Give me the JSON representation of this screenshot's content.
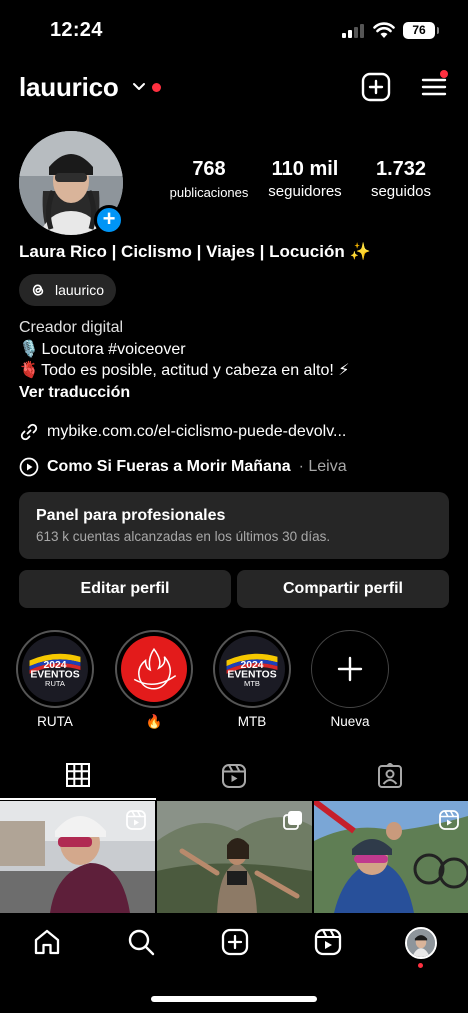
{
  "status": {
    "time": "12:24",
    "battery": "76"
  },
  "header": {
    "username": "lauurico"
  },
  "stats": {
    "posts": {
      "value": "768",
      "label": "publicaciones"
    },
    "followers": {
      "value": "110 mil",
      "label": "seguidores"
    },
    "following": {
      "value": "1.732",
      "label": "seguidos"
    }
  },
  "profile": {
    "full_name": "Laura Rico | Ciclismo | Viajes | Locución ✨",
    "threads_handle": "lauurico",
    "category": "Creador digital",
    "bio_line1": "Locutora #voiceover",
    "bio_line1_emoji": "🎙️",
    "bio_line2": "Todo es posible, actitud y cabeza en alto! ⚡",
    "bio_line2_emoji": "🫀",
    "translate": "Ver traducción",
    "link": "mybike.com.co/el-ciclismo-puede-devolv...",
    "song": "Como Si Fueras a Morir Mañana",
    "artist": "· Leiva"
  },
  "panel": {
    "title": "Panel para profesionales",
    "subtitle": "613 k cuentas alcanzadas en los últimos 30 días."
  },
  "buttons": {
    "edit": "Editar perfil",
    "share": "Compartir perfil"
  },
  "highlights": [
    {
      "label": "RUTA",
      "cover_text_top": "2024",
      "cover_text_main": "EVENTOS",
      "cover_text_sub": "RUTA"
    },
    {
      "label": "🔥"
    },
    {
      "label": "MTB",
      "cover_text_top": "2024",
      "cover_text_main": "EVENTOS",
      "cover_text_sub": "MTB"
    },
    {
      "label": "Nueva"
    }
  ],
  "tabs": [
    "grid-icon",
    "reels-icon",
    "tagged-icon"
  ],
  "nav": [
    "home-icon",
    "search-icon",
    "create-icon",
    "reels-icon",
    "profile-avatar"
  ],
  "colors": {
    "accent": "#0095f6",
    "notification": "#ff3040",
    "panel_bg": "#262626"
  }
}
